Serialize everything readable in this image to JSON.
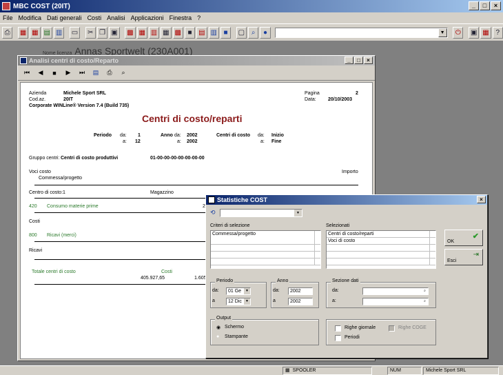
{
  "app": {
    "title": "MBC COST (20IT)"
  },
  "menu": [
    "File",
    "Modifica",
    "Dati generali",
    "Costi",
    "Analisi",
    "Applicazioni",
    "Finestra",
    "?"
  ],
  "license": {
    "label": "Nome licenza",
    "value": "Annas Sportwelt (230A001)"
  },
  "child": {
    "title": "Analisi centri di costo/Reparto"
  },
  "report": {
    "azienda_label": "Azienda",
    "azienda": "Michele Sport SRL",
    "codaz_label": "Cod.az.",
    "codaz": "20IT",
    "version": "Corporate WINLine® Version 7.4 (Build 735)",
    "pagina_label": "Pagina",
    "pagina": "2",
    "data_label": "Data:",
    "data": "20/10/2003",
    "title": "Centri di costo/reparti",
    "periodo_label": "Periodo",
    "da": "da:",
    "a": "a:",
    "periodo_da": "1",
    "periodo_a": "12",
    "anno_label": "Anno",
    "anno_da": "2002",
    "anno_a": "2002",
    "centri_label": "Centri di costo",
    "centri_da": "Inizio",
    "centri_a": "Fine",
    "gruppo_label": "Gruppo centri:",
    "gruppo": "Centri di costo produttivi",
    "gruppo_code": "01-00-00-00-00-00-00-00",
    "voci_costo": "Voci costo",
    "commessa": "Commessa/progetto",
    "importo": "Importo",
    "centro_label": "Centro di costo:1",
    "magazzino": "Magazzino",
    "row1_code": "420",
    "row1_desc": "Consumo materie prime",
    "row1_val": "2",
    "costi": "Costi",
    "row2_code": "800",
    "row2_desc": "Ricavi (merci)",
    "ricavi": "Ricavi",
    "totale_label": "Totale centri di costo",
    "totale_costi_label": "Costi",
    "totale_costi": "405.927,65",
    "totale_other": "1.605"
  },
  "dialog": {
    "title": "Statistiche COST",
    "criteri_label": "Criteri di selezione",
    "criteri": [
      "Commessa/progetto",
      "",
      "",
      "",
      ""
    ],
    "selezionati_label": "Selezionati",
    "selezionati": [
      "Centri di costo/reparti",
      "Voci di costo",
      "",
      "",
      ""
    ],
    "ok": "OK",
    "esci": "Esci",
    "periodo_group": "Periodo",
    "periodo_da_label": "da:",
    "periodo_da": "01 Ge",
    "periodo_a_label": "a",
    "periodo_a": "12 Dic",
    "anno_group": "Anno",
    "anno_da_label": "da:",
    "anno_da": "2002",
    "anno_a_label": "a",
    "anno_a": "2002",
    "sezione_group": "Sezione dati",
    "sezione_da_label": "da:",
    "sezione_a_label": "a:",
    "output_group": "Output",
    "schermo": "Schermo",
    "stampante": "Stampante",
    "righe_giornale": "Righe giornale",
    "righe_coge": "Righe COGE",
    "periodi": "Periodi"
  },
  "status": {
    "spooler": "SPOOLER",
    "num": "NUM",
    "user": "Michele Sport SRL"
  }
}
